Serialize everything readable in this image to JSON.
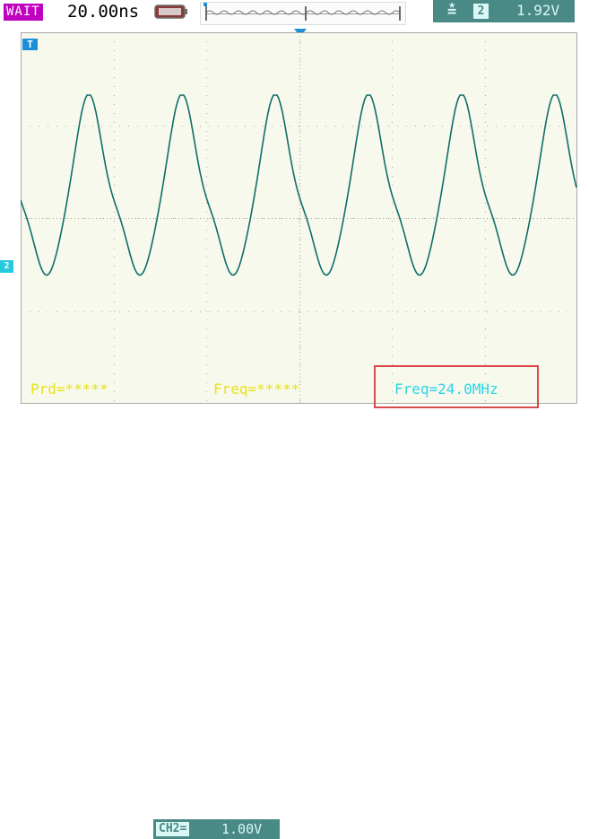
{
  "header": {
    "status": "WAIT",
    "timebase": "20.00ns",
    "trigger_source": "2",
    "trigger_level": "1.92V"
  },
  "markers": {
    "time_reference": "T",
    "channel": "2"
  },
  "measurements": {
    "period": "Prd=*****",
    "frequency_1": "Freq=*****",
    "frequency_2": "Freq=24.0MHz"
  },
  "channel_scale": {
    "label": "CH2=",
    "value": "1.00V"
  },
  "colors": {
    "trace": "#0f6e6a",
    "grid": "#a8a8a8",
    "status_bg": "#c000c0",
    "trigger_panel": "#4a8a86",
    "measure_yellow": "#e8e21a",
    "measure_cyan": "#2bd4e8"
  },
  "icons": {
    "battery": "battery-icon",
    "trigger_slope": "rising-edge-icon",
    "trigger_position": "trigger-position-icon"
  }
}
